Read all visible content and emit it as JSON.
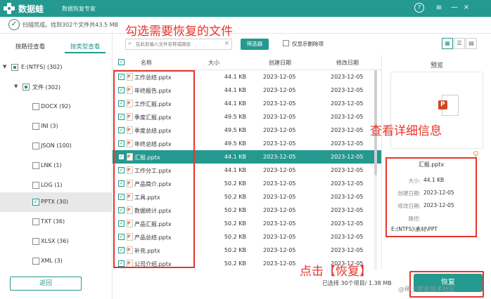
{
  "app": {
    "name": "数据蛙",
    "subtitle": "数据恢复专家",
    "controls": {
      "help": "?",
      "menu": "≡",
      "minimize": "—",
      "close": "×"
    }
  },
  "status": {
    "text": "扫描完成。找到302个文件共43.5 MB"
  },
  "annotations": {
    "select_files": "勾选需要恢复的文件",
    "view_details": "查看详细信息",
    "click_recover": "点击【恢复】"
  },
  "sidebar": {
    "tabs": [
      "按路径查看",
      "按类型查看"
    ],
    "tree": [
      {
        "label": "E:(NTFS) (302)"
      },
      {
        "label": "文件 (302)"
      },
      {
        "label": "DOCX (92)"
      },
      {
        "label": "INI (3)"
      },
      {
        "label": "JSON (100)"
      },
      {
        "label": "LNK (1)"
      },
      {
        "label": "LOG (1)"
      },
      {
        "label": "PPTX (30)"
      },
      {
        "label": "TXT (36)"
      },
      {
        "label": "XLSX (36)"
      },
      {
        "label": "XML (3)"
      }
    ],
    "back_label": "返回"
  },
  "toolbar": {
    "search_placeholder": "在此处输入文件名称或路径",
    "filter_label": "筛选器",
    "only_deleted_label": "仅显示删除项"
  },
  "table": {
    "columns": [
      "名称",
      "大小",
      "创建日期",
      "修改日期"
    ],
    "rows": [
      {
        "name": "工作总结.pptx",
        "size": "44.1 KB",
        "created": "2023-12-05",
        "modified": "2023-12-05"
      },
      {
        "name": "年终报告.pptx",
        "size": "44.1 KB",
        "created": "2023-12-05",
        "modified": "2023-12-05"
      },
      {
        "name": "工作汇报.pptx",
        "size": "44.1 KB",
        "created": "2023-12-05",
        "modified": "2023-12-05"
      },
      {
        "name": "季度汇报.pptx",
        "size": "49.5 KB",
        "created": "2023-12-05",
        "modified": "2023-12-05"
      },
      {
        "name": "季度总结.pptx",
        "size": "49.5 KB",
        "created": "2023-12-05",
        "modified": "2023-12-05"
      },
      {
        "name": "年终总结.pptx",
        "size": "49.5 KB",
        "created": "2023-12-05",
        "modified": "2023-12-05"
      },
      {
        "name": "汇报.pptx",
        "size": "44.1 KB",
        "created": "2023-12-05",
        "modified": "2023-12-05"
      },
      {
        "name": "工作分工.pptx",
        "size": "44.1 KB",
        "created": "2023-12-05",
        "modified": "2023-12-05"
      },
      {
        "name": "产品简介.pptx",
        "size": "50.2 KB",
        "created": "2023-12-05",
        "modified": "2023-12-05"
      },
      {
        "name": "工具.pptx",
        "size": "50.2 KB",
        "created": "2023-12-05",
        "modified": "2023-12-05"
      },
      {
        "name": "数据统计.pptx",
        "size": "50.2 KB",
        "created": "2023-12-05",
        "modified": "2023-12-05"
      },
      {
        "name": "产品汇报.pptx",
        "size": "50.2 KB",
        "created": "2023-12-05",
        "modified": "2023-12-05"
      },
      {
        "name": "产品总结.pptx",
        "size": "50.2 KB",
        "created": "2023-12-05",
        "modified": "2023-12-05"
      },
      {
        "name": "补充.pptx",
        "size": "50.2 KB",
        "created": "2023-12-05",
        "modified": "2023-12-05"
      },
      {
        "name": "公司介绍.pptx",
        "size": "50.2 KB",
        "created": "2023-12-05",
        "modified": "2023-12-05"
      }
    ]
  },
  "preview": {
    "title": "预览",
    "file_name": "汇报.pptx",
    "details": [
      {
        "key": "大小:",
        "value": "44.1 KB"
      },
      {
        "key": "创建日期:",
        "value": "2023-12-05"
      },
      {
        "key": "修改日期:",
        "value": "2023-12-05"
      },
      {
        "key": "路径:",
        "value": ""
      }
    ],
    "path": "E:(NTFS)\\素材\\PPT"
  },
  "footer": {
    "selection_info": "已选择 30个项目/ 1.38 MB",
    "recover_label": "恢复",
    "watermark": "@稀土掘金技术社区"
  },
  "colors": {
    "accent": "#23998f",
    "annotation": "#e8342a"
  }
}
